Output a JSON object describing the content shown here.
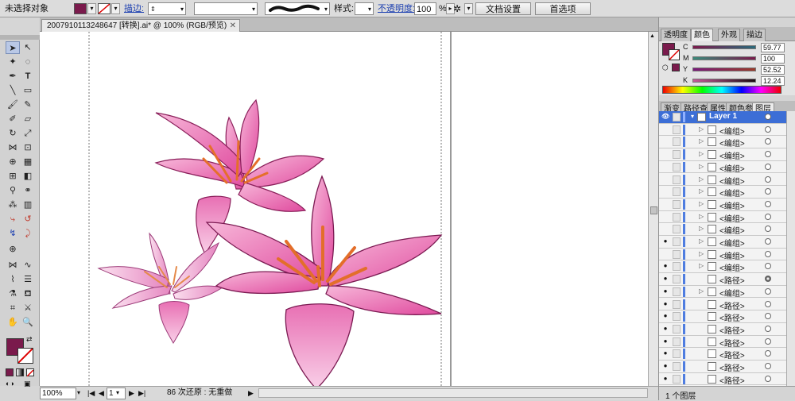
{
  "control_bar": {
    "selection_label": "未选择对象",
    "fill_color": "#7a1a4c",
    "stroke_label": "描边:",
    "style_label": "样式:",
    "opacity_label": "不透明度:",
    "opacity_value": "100",
    "opacity_unit": "%",
    "doc_settings_button": "文档设置",
    "preferences_button": "首选项"
  },
  "document": {
    "tab_title": "2007910113248647 [转换].ai* @ 100% (RGB/预览)",
    "tab_close": "✕"
  },
  "status_bar": {
    "zoom": "100%",
    "artboard": "1",
    "undo_text": "86 次还原 : 无重做"
  },
  "color_panel": {
    "tabs": [
      "透明度",
      "颜色",
      "外观",
      "描边"
    ],
    "active_tab": "颜色",
    "fill_color": "#7a1a4c",
    "channels": [
      {
        "label": "C",
        "value": "59.77"
      },
      {
        "label": "M",
        "value": "100"
      },
      {
        "label": "Y",
        "value": "52.52"
      },
      {
        "label": "K",
        "value": "12.24"
      }
    ]
  },
  "layers_panel": {
    "tabs": [
      "渐变",
      "路径查",
      "属性",
      "颜色参",
      "图层"
    ],
    "active_tab": "图层",
    "layer_name": "Layer 1",
    "rows": [
      {
        "name": "<编组>",
        "eye": false,
        "arrow": true,
        "target": "empty"
      },
      {
        "name": "<编组>",
        "eye": false,
        "arrow": true,
        "target": "empty"
      },
      {
        "name": "<编组>",
        "eye": false,
        "arrow": true,
        "target": "empty"
      },
      {
        "name": "<编组>",
        "eye": false,
        "arrow": true,
        "target": "empty"
      },
      {
        "name": "<编组>",
        "eye": false,
        "arrow": true,
        "target": "empty"
      },
      {
        "name": "<编组>",
        "eye": false,
        "arrow": true,
        "target": "empty"
      },
      {
        "name": "<编组>",
        "eye": false,
        "arrow": true,
        "target": "empty"
      },
      {
        "name": "<编组>",
        "eye": false,
        "arrow": true,
        "target": "empty"
      },
      {
        "name": "<编组>",
        "eye": false,
        "arrow": true,
        "target": "empty"
      },
      {
        "name": "<编组>",
        "eye": true,
        "arrow": true,
        "target": "empty"
      },
      {
        "name": "<编组>",
        "eye": false,
        "arrow": true,
        "target": "empty"
      },
      {
        "name": "<编组>",
        "eye": true,
        "arrow": true,
        "target": "empty"
      },
      {
        "name": "<路径>",
        "eye": true,
        "arrow": false,
        "target": "filled"
      },
      {
        "name": "<编组>",
        "eye": true,
        "arrow": true,
        "target": "empty"
      },
      {
        "name": "<路径>",
        "eye": true,
        "arrow": false,
        "target": "empty"
      },
      {
        "name": "<路径>",
        "eye": true,
        "arrow": false,
        "target": "empty"
      },
      {
        "name": "<路径>",
        "eye": true,
        "arrow": false,
        "target": "empty"
      },
      {
        "name": "<路径>",
        "eye": true,
        "arrow": false,
        "target": "empty"
      },
      {
        "name": "<路径>",
        "eye": true,
        "arrow": false,
        "target": "empty"
      },
      {
        "name": "<路径>",
        "eye": true,
        "arrow": false,
        "target": "empty"
      },
      {
        "name": "<路径>",
        "eye": true,
        "arrow": false,
        "target": "empty"
      }
    ],
    "footer_text": "1 个图层"
  }
}
